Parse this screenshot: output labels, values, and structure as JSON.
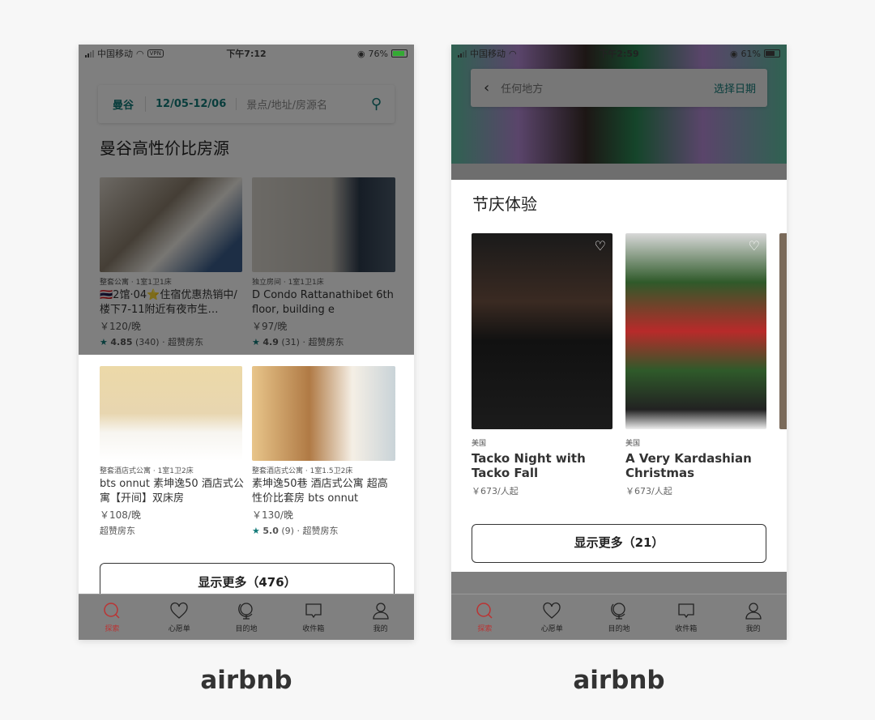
{
  "left": {
    "status": {
      "carrier": "中国移动",
      "vpn": "VPN",
      "time": "下午7:12",
      "battery": "76%"
    },
    "search": {
      "city": "曼谷",
      "dates": "12/05-12/06",
      "placeholder": "景点/地址/房源名"
    },
    "section_title": "曼谷高性价比房源",
    "listings": [
      {
        "type": "整套公寓 · 1室1卫1床",
        "title": "🇹🇭2馆·04⭐住宿优惠热销中/楼下7-11附近有夜市生…",
        "price": "￥120/晚",
        "rating": "4.85",
        "reviews": "(340)",
        "host": "· 超赞房东"
      },
      {
        "type": "独立房间 · 1室1卫1床",
        "title": "D Condo  Rattanathibet 6th floor, building e",
        "price": "￥97/晚",
        "rating": "4.9",
        "reviews": "(31)",
        "host": "· 超赞房东"
      },
      {
        "type": "整套酒店式公寓 · 1室1卫2床",
        "title": "bts onnut 素坤逸50 酒店式公寓【开间】双床房",
        "price": "￥108/晚",
        "host_only": "超赞房东"
      },
      {
        "type": "整套酒店式公寓 · 1室1.5卫2床",
        "title": "素坤逸50巷 酒店式公寓 超高性价比套房 bts onnut",
        "price": "￥130/晚",
        "rating": "5.0",
        "reviews": "(9)",
        "host": "· 超赞房东"
      }
    ],
    "more_button": "显示更多（476）"
  },
  "right": {
    "status": {
      "carrier": "中国移动",
      "time": "下午2:59",
      "battery": "61%"
    },
    "search": {
      "placeholder": "任何地方",
      "date_button": "选择日期"
    },
    "section_title": "节庆体验",
    "experiences": [
      {
        "location": "美国",
        "title": "Tacko Night with Tacko Fall",
        "price": "￥673/人起"
      },
      {
        "location": "美国",
        "title": "A Very Kardashian Christmas",
        "price": "￥673/人起"
      }
    ],
    "more_button": "显示更多（21）"
  },
  "tabs": [
    "探索",
    "心愿单",
    "目的地",
    "收件箱",
    "我的"
  ],
  "captions": [
    "airbnb",
    "airbnb"
  ],
  "colors": {
    "accent": "#127a78",
    "active_tab": "#b33333"
  }
}
